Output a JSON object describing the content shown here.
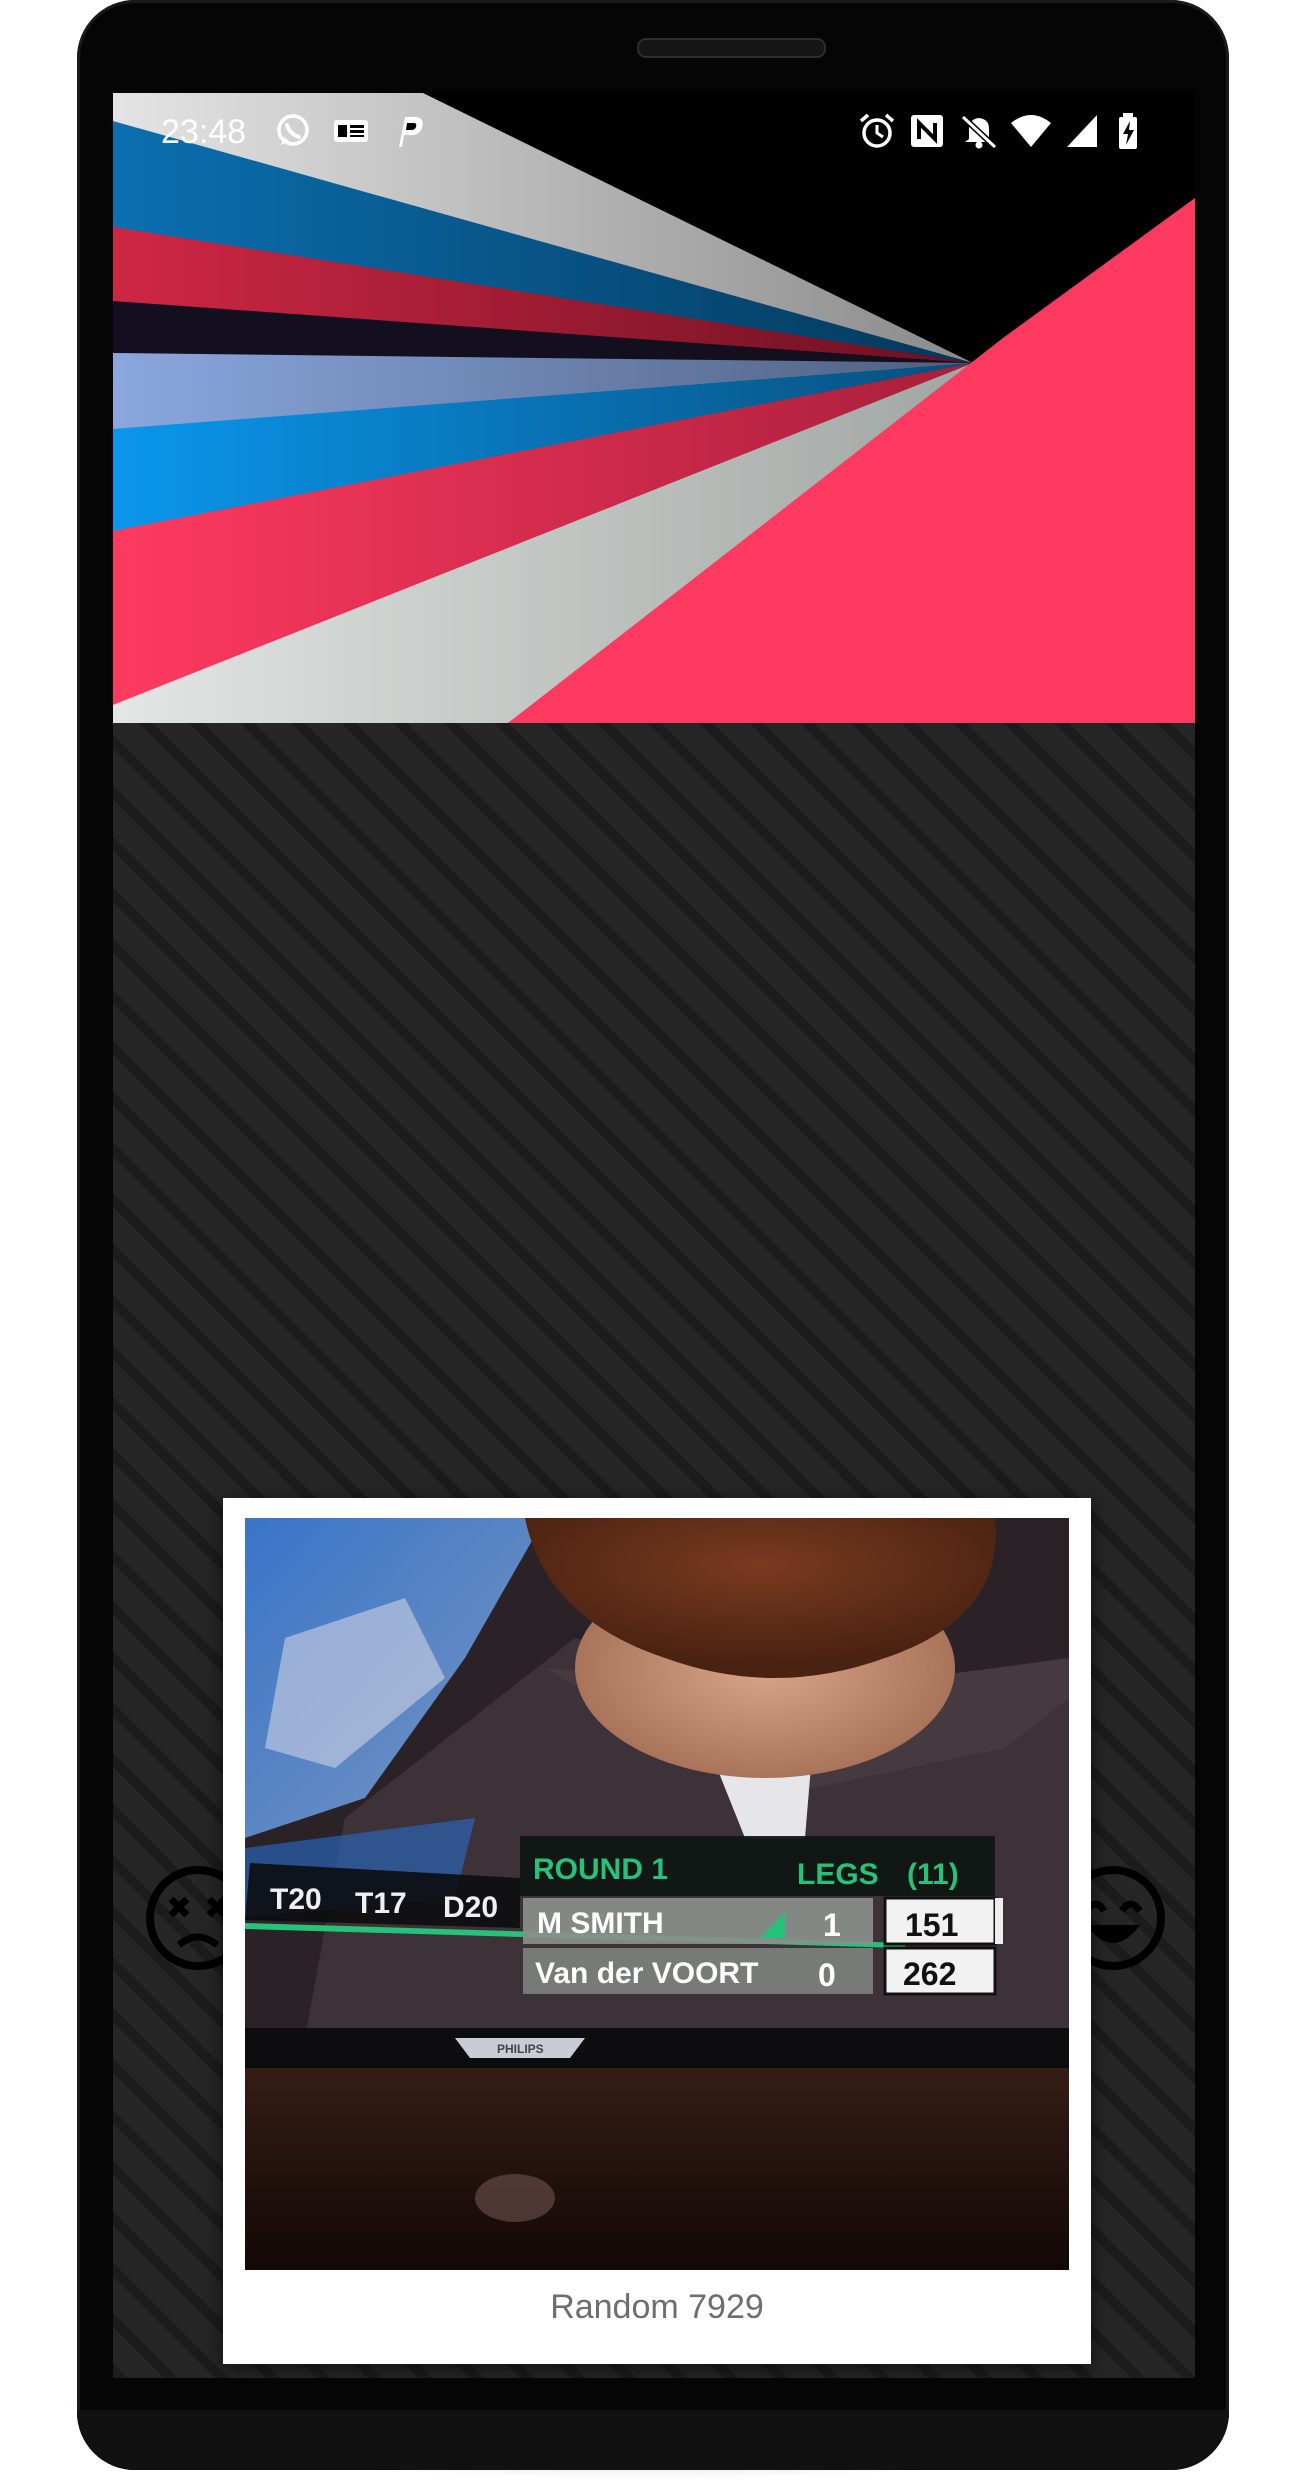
{
  "status_bar": {
    "time": "23:48",
    "left_icons": [
      "whatsapp-icon",
      "news-icon",
      "parking-icon"
    ],
    "right_icons": [
      "alarm-icon",
      "nfc-icon",
      "bell-off-icon",
      "wifi-icon",
      "signal-icon",
      "battery-charging-icon"
    ]
  },
  "header": {
    "colors": [
      "#cfcfcf",
      "#0a6aa8",
      "#c8233f",
      "#120d1d",
      "#8ea8dd",
      "#0a93e6",
      "#ff3a60",
      "#dde2df"
    ]
  },
  "swipe": {
    "left_icon": "dizzy-face-icon",
    "right_icon": "smiling-face-icon"
  },
  "card": {
    "caption": "Random 7929",
    "photo": {
      "checkouts": [
        "T20",
        "T17",
        "D20"
      ],
      "round_label": "ROUND 1",
      "legs_label": "LEGS",
      "legs_format": "(11)",
      "players": [
        {
          "name": "M SMITH",
          "legs": "1",
          "score": "151"
        },
        {
          "name": "Van der VOORT",
          "legs": "0",
          "score": "262"
        }
      ],
      "tv_brand": "PHILIPS"
    }
  }
}
